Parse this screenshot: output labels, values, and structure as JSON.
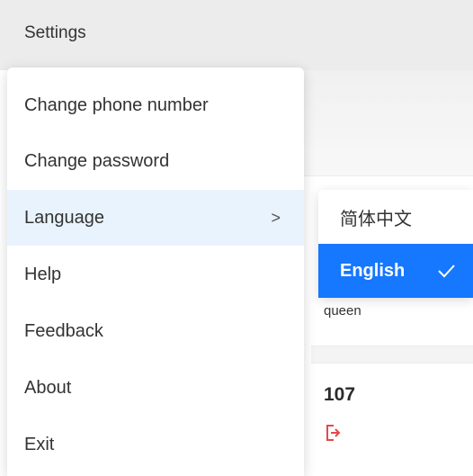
{
  "window": {
    "settings_label": "Settings"
  },
  "menu": {
    "items": [
      {
        "label": "Change phone number"
      },
      {
        "label": "Change password"
      },
      {
        "label": "Language",
        "arrow": ">"
      },
      {
        "label": "Help"
      },
      {
        "label": "Feedback"
      },
      {
        "label": "About"
      },
      {
        "label": "Exit"
      }
    ]
  },
  "language_submenu": {
    "options": [
      {
        "label": "简体中文",
        "selected": false
      },
      {
        "label": "English",
        "selected": true
      }
    ]
  },
  "background": {
    "username": "queen",
    "stat_value": "107"
  },
  "colors": {
    "accent": "#1677ff",
    "hover_bg": "#e9f3fd",
    "exit_icon": "#e8474b"
  },
  "icons": {
    "submenu_indicator": "chevron-right-icon",
    "selected_mark": "checkmark-icon",
    "exit": "exit-icon"
  }
}
